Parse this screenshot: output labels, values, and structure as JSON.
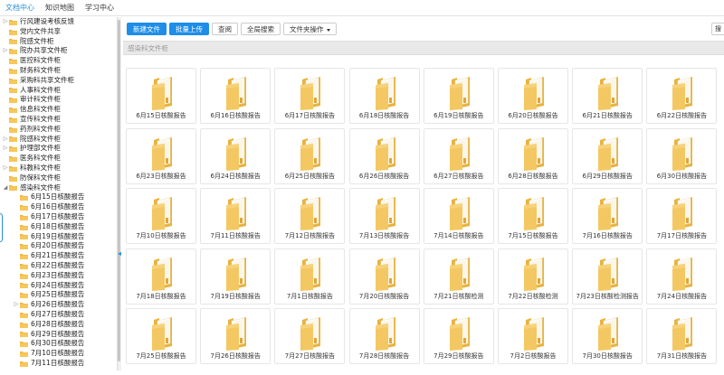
{
  "topnav": [
    "文档中心",
    "知识地图",
    "学习中心"
  ],
  "sidebar": {
    "items": [
      {
        "label": "行风建设考核反馈",
        "expand": true
      },
      {
        "label": "党内文件共享",
        "expand": false
      },
      {
        "label": "院感文件柜",
        "expand": false
      },
      {
        "label": "院办共享文件柜",
        "expand": true
      },
      {
        "label": "医控科文件柜",
        "expand": false
      },
      {
        "label": "财务科文件柜",
        "expand": false
      },
      {
        "label": "采购科共享文件柜",
        "expand": false
      },
      {
        "label": "人事科文件柜",
        "expand": false
      },
      {
        "label": "审计科文件柜",
        "expand": false
      },
      {
        "label": "信息科文件柜",
        "expand": false
      },
      {
        "label": "宣传科文件柜",
        "expand": false
      },
      {
        "label": "药剂科文件柜",
        "expand": false
      },
      {
        "label": "院感科文件柜",
        "expand": true
      },
      {
        "label": "护理部文件柜",
        "expand": true
      },
      {
        "label": "医务科文件柜",
        "expand": false
      },
      {
        "label": "科教科文件柜",
        "expand": true
      },
      {
        "label": "防保科文件柜",
        "expand": false
      },
      {
        "label": "感染科文件柜",
        "expand": true,
        "open": true
      },
      {
        "label": "6月15日核酸报告",
        "child": true
      },
      {
        "label": "6月16日核酸报告",
        "child": true
      },
      {
        "label": "6月17日核酸报告",
        "child": true
      },
      {
        "label": "6月18日核酸报告",
        "child": true
      },
      {
        "label": "6月19日核酸报告",
        "child": true
      },
      {
        "label": "6月20日核酸报告",
        "child": true
      },
      {
        "label": "6月21日核酸报告",
        "child": true
      },
      {
        "label": "6月22日核酸报告",
        "child": true
      },
      {
        "label": "6月23日核酸报告",
        "child": true
      },
      {
        "label": "6月24日核酸报告",
        "child": true
      },
      {
        "label": "6月25日核酸报告",
        "child": true
      },
      {
        "label": "6月26日核酸报告",
        "child": true,
        "expand": true
      },
      {
        "label": "6月27日核酸报告",
        "child": true
      },
      {
        "label": "6月28日核酸报告",
        "child": true
      },
      {
        "label": "6月29日核酸报告",
        "child": true
      },
      {
        "label": "6月30日核酸报告",
        "child": true
      },
      {
        "label": "7月10日核酸报告",
        "child": true
      },
      {
        "label": "7月11日核酸报告",
        "child": true
      }
    ]
  },
  "toolbar": {
    "new_file": "新建文件",
    "batch_upload": "批量上传",
    "query": "查阅",
    "global_search": "全局搜索",
    "folder_ops": "文件夹操作",
    "search_edge": "搜"
  },
  "breadcrumb": "感染科文件柜",
  "folders": [
    "6月15日核酸报告",
    "6月16日核酸报告",
    "6月17日核酸报告",
    "6月18日核酸报告",
    "6月19日核酸报告",
    "6月20日核酸报告",
    "6月21日核酸报告",
    "6月22日核酸报告",
    "6月23日核酸报告",
    "6月24日核酸报告",
    "6月25日核酸报告",
    "6月26日核酸报告",
    "6月27日核酸报告",
    "6月28日核酸报告",
    "6月29日核酸报告",
    "6月30日核酸报告",
    "7月10日核酸报告",
    "7月11日核酸报告",
    "7月12日核酸报告",
    "7月13日核酸报告",
    "7月14日核酸报告",
    "7月15日核酸报告",
    "7月16日核酸报告",
    "7月17日核酸报告",
    "7月18日核酸报告",
    "7月19日核酸报告",
    "7月1日核酸报告",
    "7月20日核酸报告",
    "7月21日核酸检测",
    "7月22日核酸检测",
    "7月23日核酸检测报告",
    "7月24日核酸报告",
    "7月25日核酸报告",
    "7月26日核酸报告",
    "7月27日核酸报告",
    "7月28日核酸报告",
    "7月29日核酸报告",
    "7月2日核酸报告",
    "7月30日核酸报告",
    "7月31日核酸报告"
  ],
  "colors": {
    "accent": "#1e8ee8",
    "folder": "#f2c45b"
  }
}
